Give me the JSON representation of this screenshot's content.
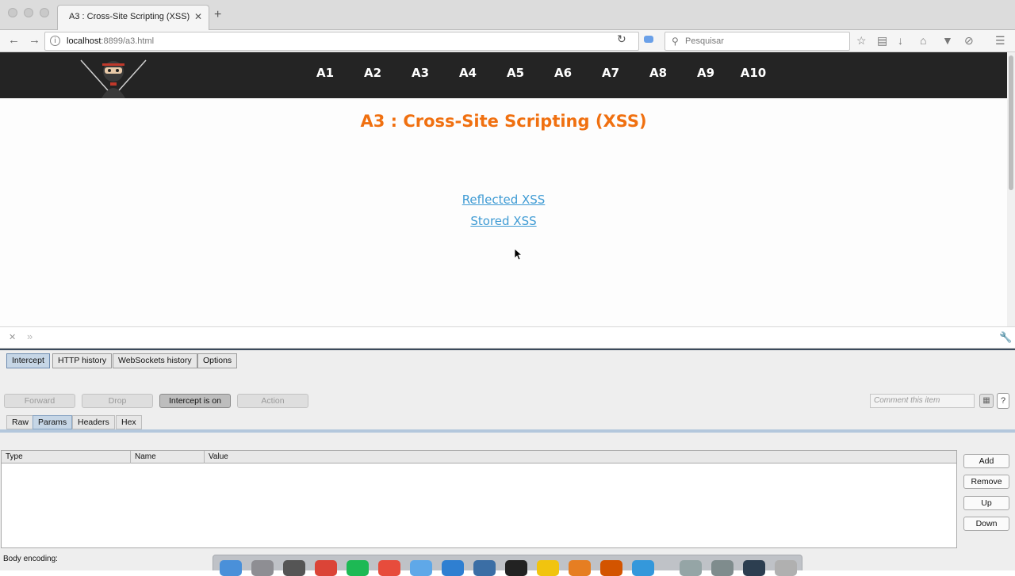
{
  "browser": {
    "tab_title": "A3 : Cross-Site Scripting (XSS)",
    "tab_close": "✕",
    "new_tab": "+",
    "url_host": "localhost",
    "url_path": ":8899/a3.html",
    "search_placeholder": "Pesquisar",
    "toolbar_icons": [
      "bookmark-star-icon",
      "reading-list-icon",
      "download-icon",
      "home-icon",
      "pocket-icon",
      "sync-icon",
      "menu-icon"
    ]
  },
  "site": {
    "nav": [
      "A1",
      "A2",
      "A3",
      "A4",
      "A5",
      "A6",
      "A7",
      "A8",
      "A9",
      "A10"
    ],
    "title": "A3 : Cross-Site Scripting (XSS)",
    "links": {
      "reflected": "Reflected XSS",
      "stored": "Stored XSS"
    }
  },
  "burp": {
    "tabs": [
      "Intercept",
      "HTTP history",
      "WebSockets history",
      "Options"
    ],
    "buttons": {
      "forward": "Forward",
      "drop": "Drop",
      "intercept": "Intercept is on",
      "action": "Action"
    },
    "comment_placeholder": "Comment this item",
    "help": "?",
    "message_tabs": [
      "Raw",
      "Params",
      "Headers",
      "Hex"
    ],
    "table_columns": [
      "Type",
      "Name",
      "Value"
    ],
    "side_buttons": [
      "Add",
      "Remove",
      "Up",
      "Down"
    ],
    "body_encoding_label": "Body encoding:"
  },
  "colors": {
    "site_header_bg": "#242424",
    "title_orange": "#f07010",
    "link_blue": "#3f9bd4",
    "burp_active_tab": "#c6d6e6"
  }
}
